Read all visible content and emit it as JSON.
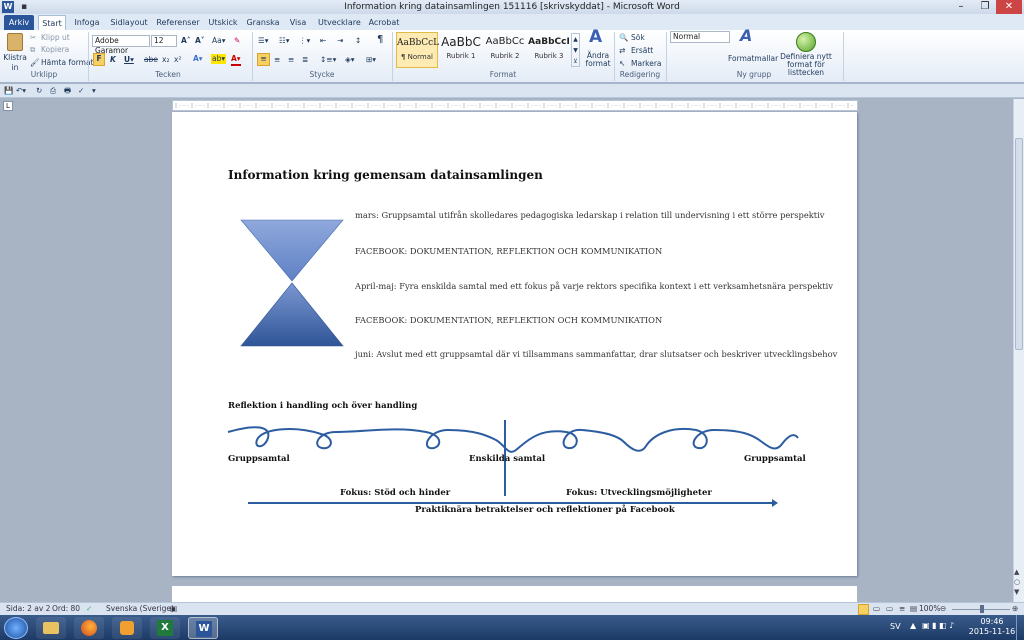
{
  "window": {
    "title": "Information kring datainsamlingen 151116 [skrivskyddat] - Microsoft Word",
    "app_logo": "W",
    "minimize": "–",
    "maximize": "❐",
    "close": "✕"
  },
  "tabs": [
    "Arkiv",
    "Start",
    "Infoga",
    "Sidlayout",
    "Referenser",
    "Utskick",
    "Granska",
    "Visa",
    "Utvecklare",
    "Acrobat"
  ],
  "ribbon": {
    "clipboard": {
      "paste": "Klistra in",
      "cut": "Klipp ut",
      "copy": "Kopiera",
      "format_painter": "Hämta format",
      "group_label": "Urklipp"
    },
    "font": {
      "family": "Adobe Garamor",
      "size": "12",
      "group_label": "Tecken"
    },
    "paragraph": {
      "group_label": "Stycke"
    },
    "styles": {
      "items": [
        {
          "preview": "AaBbCcL",
          "name": "¶ Normal"
        },
        {
          "preview": "AaBbC",
          "name": "Rubrik 1"
        },
        {
          "preview": "AaBbCc",
          "name": "Rubrik 2"
        },
        {
          "preview": "AaBbCcI",
          "name": "Rubrik 3"
        }
      ],
      "change_styles": "Ändra format",
      "group_label": "Format"
    },
    "editing": {
      "find": "Sök",
      "replace": "Ersätt",
      "select": "Markera",
      "group_label": "Redigering"
    },
    "new_group": {
      "style_select": "Normal",
      "format_templates": "Formatmallar",
      "define_new": "Definiera nytt format för listtecken",
      "group_label": "Ny grupp"
    }
  },
  "document": {
    "heading": "Information kring gemensam datainsamlingen",
    "lines": [
      "mars: Gruppsamtal utifrån skolledares pedagogiska ledarskap  i relation till undervisning  i ett större perspektiv",
      "FACEBOOK: DOKUMENTATION, REFLEKTION OCH KOMMUNIKATION",
      "April-maj: Fyra enskilda samtal med ett fokus på varje rektors specifika kontext i ett verksamhetsnära  perspektiv",
      "FACEBOOK: DOKUMENTATION, REFLEKTION OCH KOMMUNIKATION",
      "juni: Avslut med ett gruppsamtal  där vi tillsammans sammanfattar,  drar slutsatser och beskriver utvecklingsbehov"
    ],
    "reflection_heading": "Reflektion i handling och över handling",
    "label_group_left": "Gruppsamtal",
    "label_individual": "Enskilda samtal",
    "label_group_right": "Gruppsamtal",
    "focus_left": "Fokus: Stöd och hinder",
    "focus_right": "Fokus: Utvecklingsmöjligheter",
    "arrow_caption": "Praktiknära betraktelser och reflektioner på Facebook"
  },
  "status": {
    "page": "Sida: 2 av 2",
    "words": "Ord: 80",
    "language": "Svenska (Sverige)",
    "zoom": "100%"
  },
  "tray": {
    "lang": "SV",
    "time": "09:46",
    "date": "2015-11-16"
  },
  "colors": {
    "accent": "#2a5699",
    "hourglass_light": "#8fa9dc",
    "hourglass_dark": "#2f5597"
  }
}
